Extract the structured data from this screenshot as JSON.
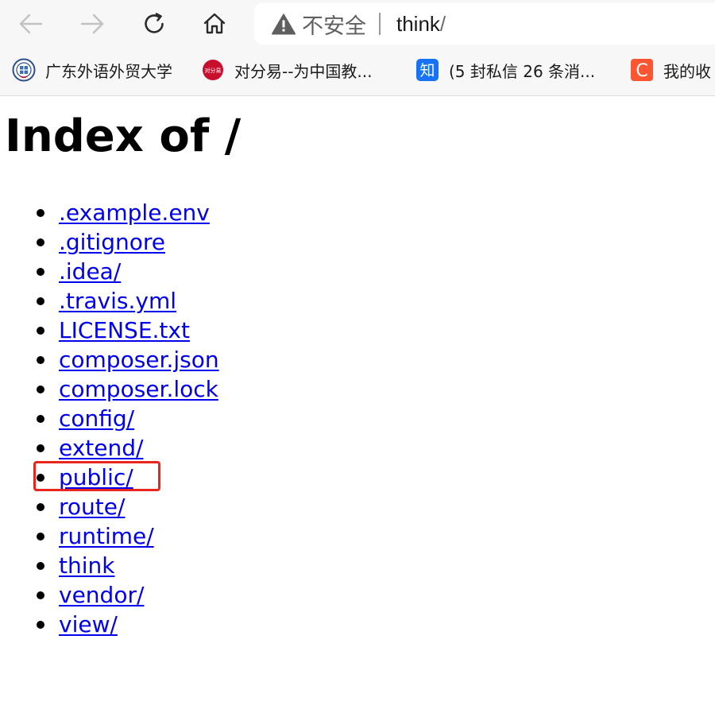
{
  "browser": {
    "security_label": "不安全",
    "url_main": "think",
    "url_suffix": "/",
    "bookmarks": [
      {
        "label": "广东外语外贸大学",
        "icon": "university-seal-icon"
      },
      {
        "label": "对分易--为中国教...",
        "icon": "duifenyi-logo-icon",
        "icon_text": "对分易"
      },
      {
        "label": "(5 封私信  26 条消...",
        "icon": "zhihu-logo-icon",
        "icon_text": "知"
      },
      {
        "label": "我的收",
        "icon": "csdn-logo-icon",
        "icon_text": "C"
      }
    ]
  },
  "page": {
    "title": "Index of /",
    "files": [
      ".example.env",
      ".gitignore",
      ".idea/",
      ".travis.yml",
      "LICENSE.txt",
      "composer.json",
      "composer.lock",
      "config/",
      "extend/",
      "public/",
      "route/",
      "runtime/",
      "think",
      "vendor/",
      "view/"
    ]
  },
  "colors": {
    "link": "#0000ee",
    "highlight": "#e8261c",
    "zhihu": "#1772f6",
    "csdn": "#fc5531",
    "duifenyi": "#c8102e"
  }
}
